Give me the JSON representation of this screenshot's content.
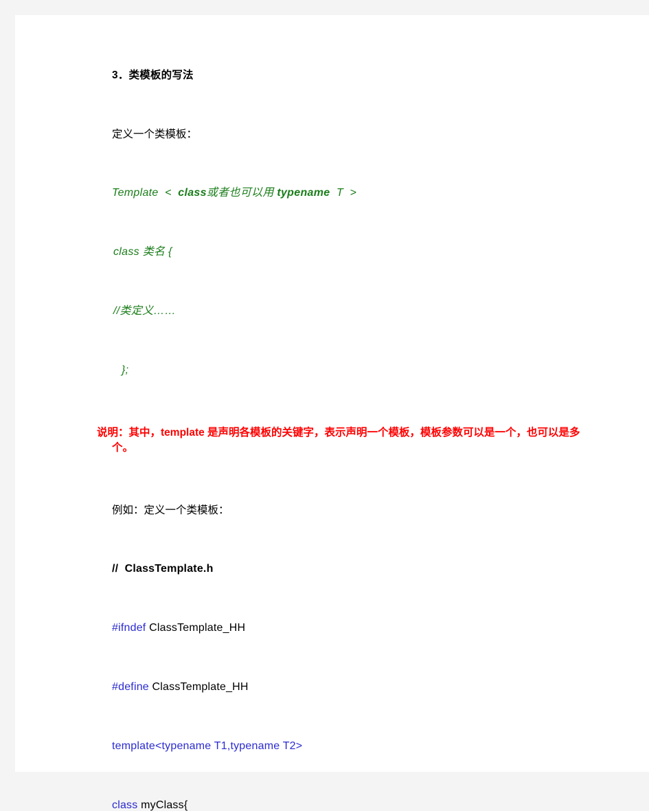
{
  "document": {
    "background_color": "#f4f4f4",
    "page_color": "#ffffff",
    "colors": {
      "text": "#000000",
      "code_green": "#1a7d1a",
      "note_red": "#ff0000",
      "keyword_blue": "#2b2bd0"
    }
  },
  "heading": {
    "text": "3．类模板的写法"
  },
  "paragraphs": {
    "define_intro": "定义一个类模板：",
    "example_intro": "例如：定义一个类模板："
  },
  "template_sketch": {
    "line1": {
      "prefix": "Template  <  ",
      "kw1": "class",
      "mid": "或者也可以用 ",
      "kw2": "typename",
      "suffix": "  T  >"
    },
    "line2": "class 类名 {",
    "line3": "//类定义……",
    "line4": "};"
  },
  "note": {
    "line1": "说明：其中，template 是声明各模板的关键字，表示声明一个模板，模板参数可以",
    "line2": "是一个，也可以是多个。",
    "full": "说明：其中，template 是声明各模板的关键字，表示声明一个模板，模板参数可以是一个，也可以是多个。"
  },
  "code_listing": {
    "file_comment": "//  ClassTemplate.h",
    "lines": [
      {
        "keyword": "#ifndef",
        "rest": " ClassTemplate_HH"
      },
      {
        "keyword": "#define",
        "rest": " ClassTemplate_HH"
      },
      {
        "keyword": "template<typename",
        "rest": "",
        "keyword2": " T1,typename",
        "rest2": " T2>"
      },
      {
        "keyword": "class",
        "rest": " myClass{"
      }
    ]
  }
}
